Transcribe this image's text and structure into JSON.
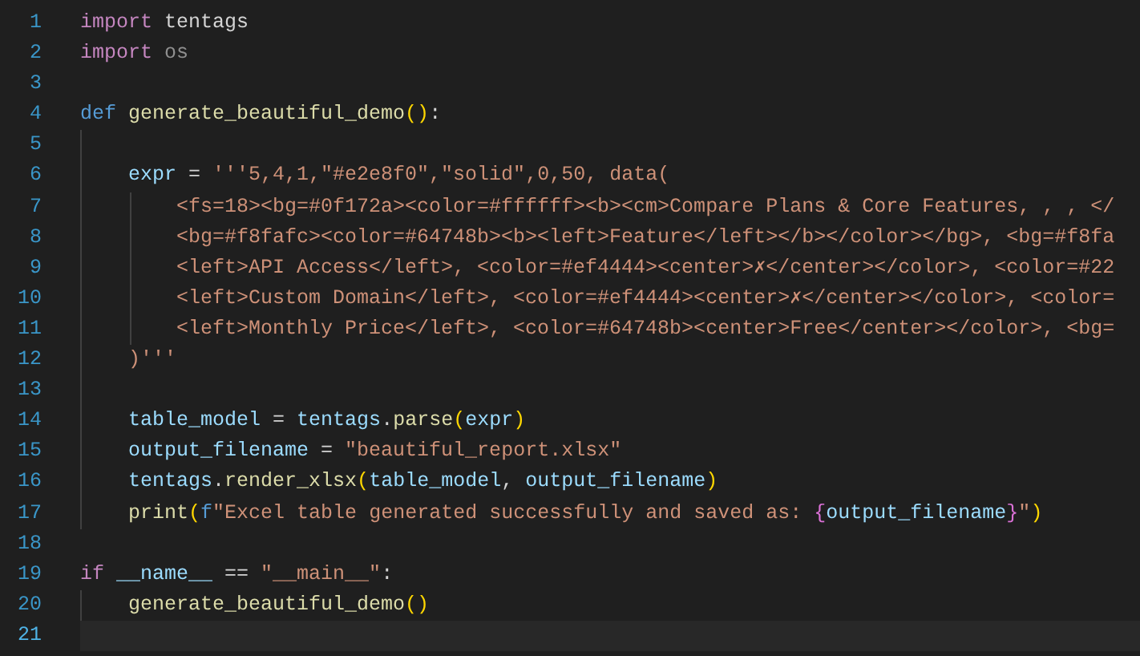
{
  "editor": {
    "lines": [
      {
        "number": "1",
        "current": false,
        "tokens": [
          {
            "kind": "keyword",
            "text": "import"
          },
          {
            "kind": "plain",
            "text": " tentags"
          }
        ]
      },
      {
        "number": "2",
        "current": false,
        "tokens": [
          {
            "kind": "keyword",
            "text": "import"
          },
          {
            "kind": "dim",
            "text": " os"
          }
        ]
      },
      {
        "number": "3",
        "current": false
      },
      {
        "number": "4",
        "current": false,
        "tokens": [
          {
            "kind": "storage",
            "text": "def"
          },
          {
            "kind": "function",
            "text": " generate_beautiful_demo"
          },
          {
            "kind": "paren1",
            "text": "()"
          },
          {
            "kind": "plain",
            "text": ":"
          }
        ]
      },
      {
        "number": "5",
        "current": false
      },
      {
        "number": "6",
        "current": false,
        "tokens": [
          {
            "kind": "variable",
            "text": "    expr"
          },
          {
            "kind": "plain",
            "text": " = "
          },
          {
            "kind": "string",
            "text": "'''5,4,1,\"#e2e8f0\",\"solid\",0,50, data("
          }
        ]
      },
      {
        "number": "7",
        "current": false,
        "tokens": [
          {
            "kind": "string",
            "text": "        <fs=18><bg=#0f172a><color=#ffffff><b><cm>Compare Plans & Core Features, , , </"
          }
        ]
      },
      {
        "number": "8",
        "current": false,
        "tokens": [
          {
            "kind": "string",
            "text": "        <bg=#f8fafc><color=#64748b><b><left>Feature</left></b></color></bg>, <bg=#f8fa"
          }
        ]
      },
      {
        "number": "9",
        "current": false,
        "tokens": [
          {
            "kind": "string",
            "text": "        <left>API Access</left>, <color=#ef4444><center>✗</center></color>, <color=#22"
          }
        ]
      },
      {
        "number": "10",
        "current": false,
        "tokens": [
          {
            "kind": "string",
            "text": "        <left>Custom Domain</left>, <color=#ef4444><center>✗</center></color>, <color="
          }
        ]
      },
      {
        "number": "11",
        "current": false,
        "tokens": [
          {
            "kind": "string",
            "text": "        <left>Monthly Price</left>, <color=#64748b><center>Free</center></color>, <bg="
          }
        ]
      },
      {
        "number": "12",
        "current": false,
        "tokens": [
          {
            "kind": "string",
            "text": "    )'''"
          }
        ]
      },
      {
        "number": "13",
        "current": false
      },
      {
        "number": "14",
        "current": false,
        "tokens": [
          {
            "kind": "variable",
            "text": "    table_model"
          },
          {
            "kind": "plain",
            "text": " = "
          },
          {
            "kind": "variable",
            "text": "tentags"
          },
          {
            "kind": "plain",
            "text": "."
          },
          {
            "kind": "function",
            "text": "parse"
          },
          {
            "kind": "paren1",
            "text": "("
          },
          {
            "kind": "variable",
            "text": "expr"
          },
          {
            "kind": "paren1",
            "text": ")"
          }
        ]
      },
      {
        "number": "15",
        "current": false,
        "tokens": [
          {
            "kind": "variable",
            "text": "    output_filename"
          },
          {
            "kind": "plain",
            "text": " = "
          },
          {
            "kind": "string",
            "text": "\"beautiful_report.xlsx\""
          }
        ]
      },
      {
        "number": "16",
        "current": false,
        "tokens": [
          {
            "kind": "variable",
            "text": "    tentags"
          },
          {
            "kind": "plain",
            "text": "."
          },
          {
            "kind": "function",
            "text": "render_xlsx"
          },
          {
            "kind": "paren1",
            "text": "("
          },
          {
            "kind": "variable",
            "text": "table_model"
          },
          {
            "kind": "plain",
            "text": ","
          },
          {
            "kind": "variable",
            "text": " output_filename"
          },
          {
            "kind": "paren1",
            "text": ")"
          }
        ]
      },
      {
        "number": "17",
        "current": false,
        "tokens": [
          {
            "kind": "function",
            "text": "    print"
          },
          {
            "kind": "paren1",
            "text": "("
          },
          {
            "kind": "storage",
            "text": "f"
          },
          {
            "kind": "string",
            "text": "\"Excel table generated successfully and saved as: "
          },
          {
            "kind": "paren2",
            "text": "{"
          },
          {
            "kind": "variable",
            "text": "output_filename"
          },
          {
            "kind": "paren2",
            "text": "}"
          },
          {
            "kind": "string",
            "text": "\""
          },
          {
            "kind": "paren1",
            "text": ")"
          }
        ]
      },
      {
        "number": "18",
        "current": false
      },
      {
        "number": "19",
        "current": false,
        "tokens": [
          {
            "kind": "keyword",
            "text": "if"
          },
          {
            "kind": "variable",
            "text": " __name__"
          },
          {
            "kind": "plain",
            "text": " == "
          },
          {
            "kind": "string",
            "text": "\"__main__\""
          },
          {
            "kind": "plain",
            "text": ":"
          }
        ]
      },
      {
        "number": "20",
        "current": false,
        "tokens": [
          {
            "kind": "function",
            "text": "    generate_beautiful_demo"
          },
          {
            "kind": "paren1",
            "text": "()"
          }
        ]
      },
      {
        "number": "21",
        "current": true
      }
    ]
  }
}
